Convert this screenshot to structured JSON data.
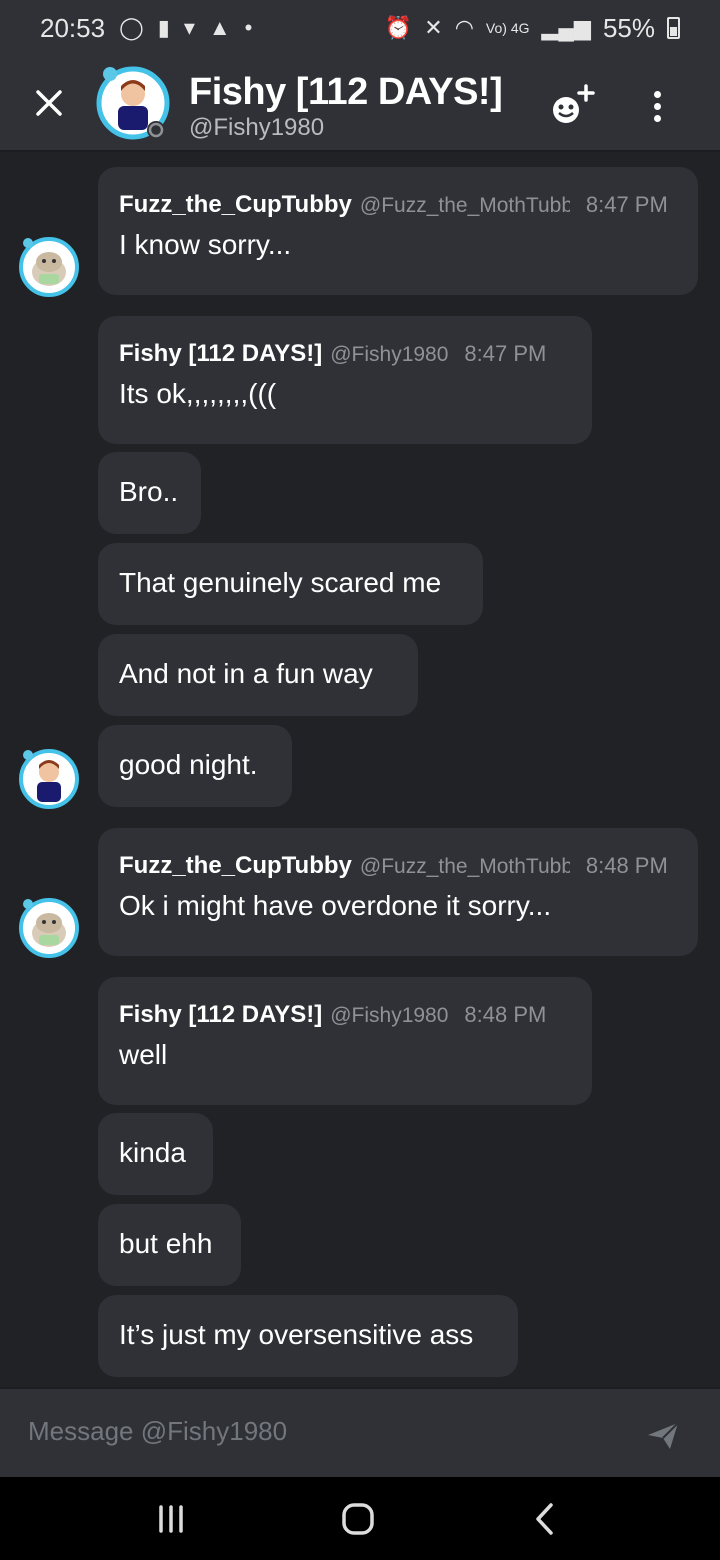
{
  "status": {
    "time": "20:53",
    "battery": "55%",
    "net_label": "Vo) 4G"
  },
  "header": {
    "title": "Fishy [112 DAYS!]",
    "subtitle": "@Fishy1980"
  },
  "messages": [
    {
      "author": "Fuzz_the_CupTubby",
      "handle": "@Fuzz_the_MothTubby",
      "time": "8:47 PM",
      "text": "I know sorry..."
    },
    {
      "author": "Fishy [112 DAYS!]",
      "handle": "@Fishy1980",
      "time": "8:47 PM",
      "text": "Its ok,,,,,,,,((("
    },
    {
      "text": "Bro.."
    },
    {
      "text": "That genuinely scared me"
    },
    {
      "text": "And not in a fun way"
    },
    {
      "text": "good night."
    },
    {
      "author": "Fuzz_the_CupTubby",
      "handle": "@Fuzz_the_MothTubby",
      "time": "8:48 PM",
      "text": "Ok i might have overdone it sorry..."
    },
    {
      "author": "Fishy [112 DAYS!]",
      "handle": "@Fishy1980",
      "time": "8:48 PM",
      "text": "well"
    },
    {
      "text": "kinda"
    },
    {
      "text": "but ehh"
    },
    {
      "text": "It’s just my oversensitive ass"
    }
  ],
  "composer": {
    "placeholder": "Message @Fishy1980"
  },
  "colors": {
    "background": "#202225",
    "bubble": "#2f3136",
    "header": "#2f3136",
    "avatar_ring": "#44c2e8",
    "muted_text": "#8e9297"
  },
  "icons": [
    "close-icon",
    "add-friend-icon",
    "more-options-icon",
    "send-icon",
    "recent-apps-icon",
    "home-icon",
    "back-icon"
  ]
}
